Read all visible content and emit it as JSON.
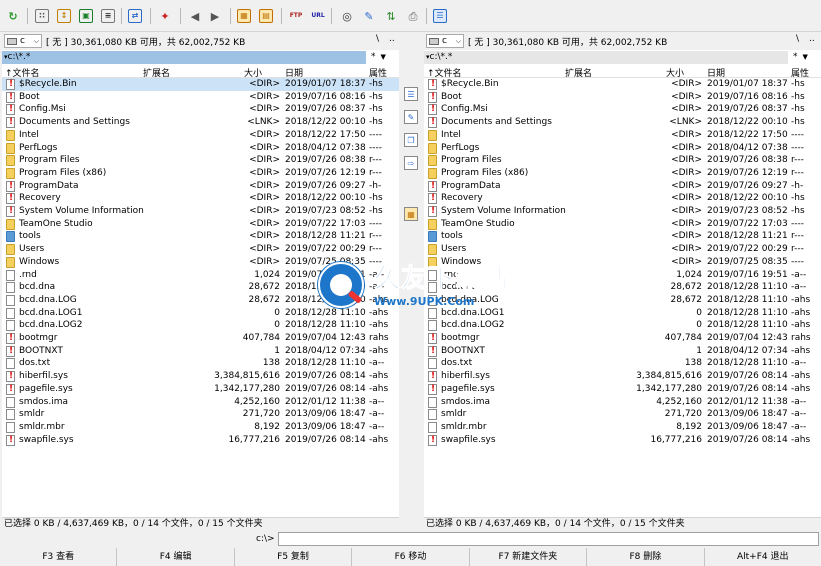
{
  "toolbar": {
    "icons": [
      "refresh-icon",
      "brief-view-icon",
      "tree-view-icon",
      "thumbnail-view-icon",
      "compare-icon",
      "sync-dirs-icon",
      "select-icon",
      "back-arrow-icon",
      "forward-arrow-icon",
      "pack-icon",
      "unpack-icon",
      "ftp-connect-icon",
      "url-connect-icon",
      "find-icon",
      "multi-rename-icon",
      "dir-sync-icon",
      "print-icon",
      "notepad-icon"
    ],
    "ftp_label": "FTP",
    "url_label": "URL"
  },
  "left_panel": {
    "drive_letter": "c",
    "drive_info": "[ 无 ]  30,361,080 KB 可用，共 62,002,752 KB",
    "root_button": "\\",
    "up_button": "..",
    "path": "c:\\*.*",
    "filter": "*",
    "columns": {
      "name": "↑文件名",
      "ext": "扩展名",
      "size": "大小",
      "date": "日期",
      "attr": "属性"
    },
    "status": "已选择 0 KB / 4,637,469 KB，0 / 14 个文件，0 / 15 个文件夹",
    "rows": [
      {
        "icon": "warn",
        "name": "$Recycle.Bin",
        "size": "<DIR>",
        "date": "2019/01/07 18:37",
        "attr": "-hs",
        "selected": true
      },
      {
        "icon": "warn",
        "name": "Boot",
        "size": "<DIR>",
        "date": "2019/07/16 08:16",
        "attr": "-hs"
      },
      {
        "icon": "warn",
        "name": "Config.Msi",
        "size": "<DIR>",
        "date": "2019/07/26 08:37",
        "attr": "-hs"
      },
      {
        "icon": "warn",
        "name": "Documents and Settings",
        "size": "<LNK>",
        "date": "2018/12/22 00:10",
        "attr": "-hs"
      },
      {
        "icon": "folder",
        "name": "Intel",
        "size": "<DIR>",
        "date": "2018/12/22 17:50",
        "attr": "----"
      },
      {
        "icon": "folder",
        "name": "PerfLogs",
        "size": "<DIR>",
        "date": "2018/04/12 07:38",
        "attr": "----"
      },
      {
        "icon": "folder",
        "name": "Program Files",
        "size": "<DIR>",
        "date": "2019/07/26 08:38",
        "attr": "r---"
      },
      {
        "icon": "folder",
        "name": "Program Files (x86)",
        "size": "<DIR>",
        "date": "2019/07/26 12:19",
        "attr": "r---"
      },
      {
        "icon": "warn",
        "name": "ProgramData",
        "size": "<DIR>",
        "date": "2019/07/26 09:27",
        "attr": "-h-"
      },
      {
        "icon": "warn",
        "name": "Recovery",
        "size": "<DIR>",
        "date": "2018/12/22 00:10",
        "attr": "-hs"
      },
      {
        "icon": "warn",
        "name": "System Volume Information",
        "size": "<DIR>",
        "date": "2019/07/23 08:52",
        "attr": "-hs"
      },
      {
        "icon": "folder",
        "name": "TeamOne Studio",
        "size": "<DIR>",
        "date": "2019/07/22 17:03",
        "attr": "----"
      },
      {
        "icon": "folder-blue",
        "name": "tools",
        "size": "<DIR>",
        "date": "2018/12/28 11:21",
        "attr": "r---"
      },
      {
        "icon": "folder",
        "name": "Users",
        "size": "<DIR>",
        "date": "2019/07/22 00:29",
        "attr": "r---"
      },
      {
        "icon": "folder",
        "name": "Windows",
        "size": "<DIR>",
        "date": "2019/07/25 08:35",
        "attr": "----"
      },
      {
        "icon": "file",
        "name": ".rnd",
        "size": "1,024",
        "date": "2019/07/16 19:51",
        "attr": "-a--"
      },
      {
        "icon": "file",
        "name": "bcd.dna",
        "size": "28,672",
        "date": "2018/12/28 11:10",
        "attr": "-a--"
      },
      {
        "icon": "file",
        "name": "bcd.dna.LOG",
        "size": "28,672",
        "date": "2018/12/28 11:10",
        "attr": "-ahs"
      },
      {
        "icon": "file",
        "name": "bcd.dna.LOG1",
        "size": "0",
        "date": "2018/12/28 11:10",
        "attr": "-ahs"
      },
      {
        "icon": "file",
        "name": "bcd.dna.LOG2",
        "size": "0",
        "date": "2018/12/28 11:10",
        "attr": "-ahs"
      },
      {
        "icon": "warn",
        "name": "bootmgr",
        "size": "407,784",
        "date": "2019/07/04 12:43",
        "attr": "rahs"
      },
      {
        "icon": "warn",
        "name": "BOOTNXT",
        "size": "1",
        "date": "2018/04/12 07:34",
        "attr": "-ahs"
      },
      {
        "icon": "file",
        "name": "dos.txt",
        "size": "138",
        "date": "2018/12/28 11:10",
        "attr": "-a--"
      },
      {
        "icon": "warn",
        "name": "hiberfil.sys",
        "size": "3,384,815,616",
        "date": "2019/07/26 08:14",
        "attr": "-ahs"
      },
      {
        "icon": "warn",
        "name": "pagefile.sys",
        "size": "1,342,177,280",
        "date": "2019/07/26 08:14",
        "attr": "-ahs"
      },
      {
        "icon": "file",
        "name": "smdos.ima",
        "size": "4,252,160",
        "date": "2012/01/12 11:38",
        "attr": "-a--"
      },
      {
        "icon": "file",
        "name": "smldr",
        "size": "271,720",
        "date": "2013/09/06 18:47",
        "attr": "-a--"
      },
      {
        "icon": "file",
        "name": "smldr.mbr",
        "size": "8,192",
        "date": "2013/09/06 18:47",
        "attr": "-a--"
      },
      {
        "icon": "warn",
        "name": "swapfile.sys",
        "size": "16,777,216",
        "date": "2019/07/26 08:14",
        "attr": "-ahs"
      }
    ]
  },
  "right_panel": {
    "drive_letter": "c",
    "drive_info": "[ 无 ]  30,361,080 KB 可用，共 62,002,752 KB",
    "root_button": "\\",
    "up_button": "..",
    "path": "c:\\*.*",
    "filter": "*",
    "columns": {
      "name": "↑文件名",
      "ext": "扩展名",
      "size": "大小",
      "date": "日期",
      "attr": "属性"
    },
    "status": "已选择 0 KB / 4,637,469 KB，0 / 14 个文件，0 / 15 个文件夹",
    "rows": [
      {
        "icon": "warn",
        "name": "$Recycle.Bin",
        "size": "<DIR>",
        "date": "2019/01/07 18:37",
        "attr": "-hs"
      },
      {
        "icon": "warn",
        "name": "Boot",
        "size": "<DIR>",
        "date": "2019/07/16 08:16",
        "attr": "-hs"
      },
      {
        "icon": "warn",
        "name": "Config.Msi",
        "size": "<DIR>",
        "date": "2019/07/26 08:37",
        "attr": "-hs"
      },
      {
        "icon": "warn",
        "name": "Documents and Settings",
        "size": "<LNK>",
        "date": "2018/12/22 00:10",
        "attr": "-hs"
      },
      {
        "icon": "folder",
        "name": "Intel",
        "size": "<DIR>",
        "date": "2018/12/22 17:50",
        "attr": "----"
      },
      {
        "icon": "folder",
        "name": "PerfLogs",
        "size": "<DIR>",
        "date": "2018/04/12 07:38",
        "attr": "----"
      },
      {
        "icon": "folder",
        "name": "Program Files",
        "size": "<DIR>",
        "date": "2019/07/26 08:38",
        "attr": "r---"
      },
      {
        "icon": "folder",
        "name": "Program Files (x86)",
        "size": "<DIR>",
        "date": "2019/07/26 12:19",
        "attr": "r---"
      },
      {
        "icon": "warn",
        "name": "ProgramData",
        "size": "<DIR>",
        "date": "2019/07/26 09:27",
        "attr": "-h-"
      },
      {
        "icon": "warn",
        "name": "Recovery",
        "size": "<DIR>",
        "date": "2018/12/22 00:10",
        "attr": "-hs"
      },
      {
        "icon": "warn",
        "name": "System Volume Information",
        "size": "<DIR>",
        "date": "2019/07/23 08:52",
        "attr": "-hs"
      },
      {
        "icon": "folder",
        "name": "TeamOne Studio",
        "size": "<DIR>",
        "date": "2019/07/22 17:03",
        "attr": "----"
      },
      {
        "icon": "folder-blue",
        "name": "tools",
        "size": "<DIR>",
        "date": "2018/12/28 11:21",
        "attr": "r---"
      },
      {
        "icon": "folder",
        "name": "Users",
        "size": "<DIR>",
        "date": "2019/07/22 00:29",
        "attr": "r---"
      },
      {
        "icon": "folder",
        "name": "Windows",
        "size": "<DIR>",
        "date": "2019/07/25 08:35",
        "attr": "----"
      },
      {
        "icon": "file",
        "name": ".rnd",
        "size": "1,024",
        "date": "2019/07/16 19:51",
        "attr": "-a--"
      },
      {
        "icon": "file",
        "name": "bcd.dna",
        "size": "28,672",
        "date": "2018/12/28 11:10",
        "attr": "-a--"
      },
      {
        "icon": "file",
        "name": "bcd.dna.LOG",
        "size": "28,672",
        "date": "2018/12/28 11:10",
        "attr": "-ahs"
      },
      {
        "icon": "file",
        "name": "bcd.dna.LOG1",
        "size": "0",
        "date": "2018/12/28 11:10",
        "attr": "-ahs"
      },
      {
        "icon": "file",
        "name": "bcd.dna.LOG2",
        "size": "0",
        "date": "2018/12/28 11:10",
        "attr": "-ahs"
      },
      {
        "icon": "warn",
        "name": "bootmgr",
        "size": "407,784",
        "date": "2019/07/04 12:43",
        "attr": "rahs"
      },
      {
        "icon": "warn",
        "name": "BOOTNXT",
        "size": "1",
        "date": "2018/04/12 07:34",
        "attr": "-ahs"
      },
      {
        "icon": "file",
        "name": "dos.txt",
        "size": "138",
        "date": "2018/12/28 11:10",
        "attr": "-a--"
      },
      {
        "icon": "warn",
        "name": "hiberfil.sys",
        "size": "3,384,815,616",
        "date": "2019/07/26 08:14",
        "attr": "-ahs"
      },
      {
        "icon": "warn",
        "name": "pagefile.sys",
        "size": "1,342,177,280",
        "date": "2019/07/26 08:14",
        "attr": "-ahs"
      },
      {
        "icon": "file",
        "name": "smdos.ima",
        "size": "4,252,160",
        "date": "2012/01/12 11:38",
        "attr": "-a--"
      },
      {
        "icon": "file",
        "name": "smldr",
        "size": "271,720",
        "date": "2013/09/06 18:47",
        "attr": "-a--"
      },
      {
        "icon": "file",
        "name": "smldr.mbr",
        "size": "8,192",
        "date": "2013/09/06 18:47",
        "attr": "-a--"
      },
      {
        "icon": "warn",
        "name": "swapfile.sys",
        "size": "16,777,216",
        "date": "2019/07/26 08:14",
        "attr": "-ahs"
      }
    ]
  },
  "command_line": {
    "label": "c:\\>",
    "value": ""
  },
  "function_keys": [
    {
      "label": "F3 查看"
    },
    {
      "label": "F4 编辑"
    },
    {
      "label": "F5 复制"
    },
    {
      "label": "F6 移动"
    },
    {
      "label": "F7 新建文件夹"
    },
    {
      "label": "F8 删除"
    },
    {
      "label": "Alt+F4 退出"
    }
  ],
  "watermark": {
    "title": "久友下载站",
    "url": "Www.9UPK.Com"
  },
  "colors": {
    "selection": "#cce2f7",
    "path_highlight": "#9ec2e4",
    "folder": "#f5d05e",
    "accent": "#1d76c9"
  }
}
